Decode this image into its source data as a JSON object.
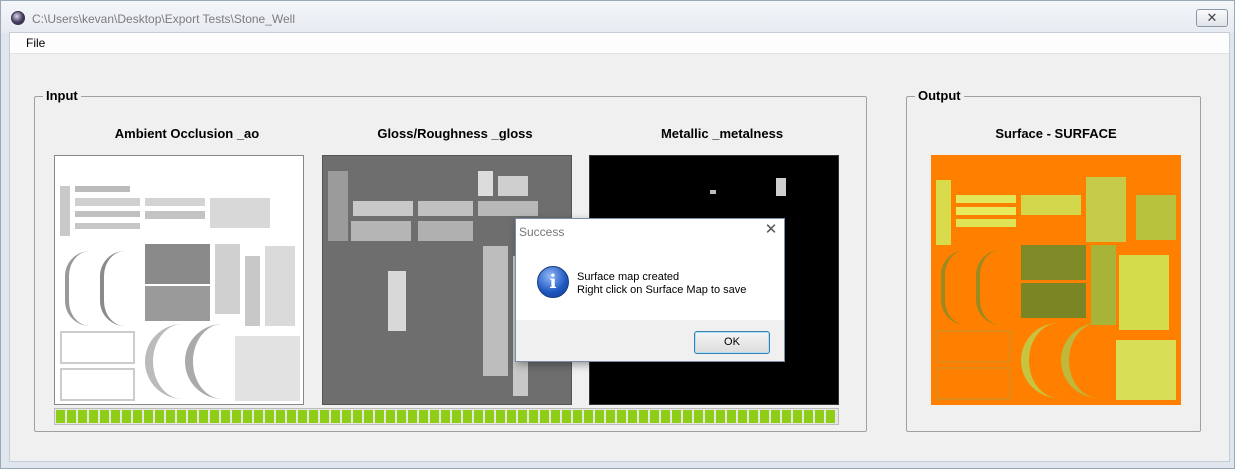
{
  "window": {
    "title": "C:\\Users\\kevan\\Desktop\\Export Tests\\Stone_Well",
    "close_glyph": "✕",
    "icon": "app-icon"
  },
  "menu": {
    "items": [
      {
        "label": "File"
      }
    ]
  },
  "input_group": {
    "label": "Input",
    "panels": [
      {
        "caption": "Ambient Occlusion _ao"
      },
      {
        "caption": "Gloss/Roughness _gloss"
      },
      {
        "caption": "Metallic _metalness"
      }
    ]
  },
  "output_group": {
    "label": "Output",
    "panels": [
      {
        "caption": "Surface - SURFACE"
      }
    ]
  },
  "progress": {
    "value": 1.0
  },
  "dialog": {
    "title": "Success",
    "close_glyph": "✕",
    "icon": "info-icon",
    "icon_glyph": "i",
    "message_line1": "Surface map created",
    "message_line2": "Right click on Surface Map to save",
    "ok_label": "OK"
  },
  "colors": {
    "progress": "#8fce17",
    "surface_bg": "#ff7f00",
    "info_icon": "#1d56c0"
  }
}
